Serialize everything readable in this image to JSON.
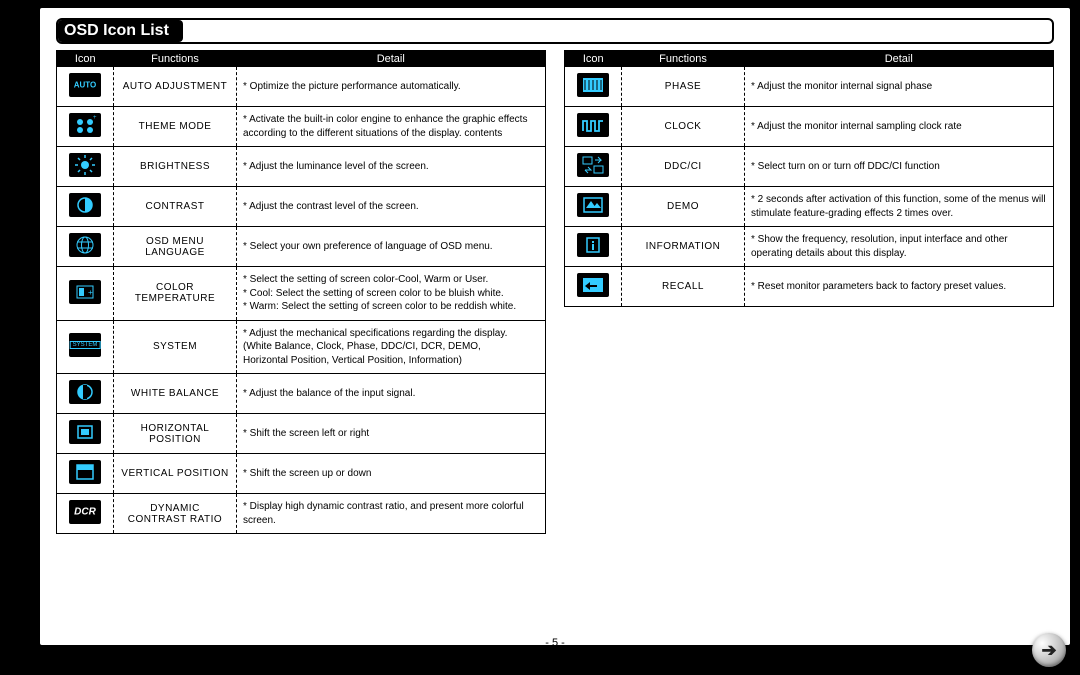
{
  "title": "OSD Icon List",
  "page_number": "- 5 -",
  "headers": {
    "icon": "Icon",
    "fn": "Functions",
    "detail": "Detail"
  },
  "left": [
    {
      "id": "auto",
      "fn": "AUTO ADJUSTMENT",
      "detail": "* Optimize the picture performance automatically."
    },
    {
      "id": "theme",
      "fn": "THEME MODE",
      "detail": "* Activate the built-in color engine to enhance the graphic effects according to the different situations of the display. contents"
    },
    {
      "id": "brightness",
      "fn": "BRIGHTNESS",
      "detail": "* Adjust the luminance level of the screen."
    },
    {
      "id": "contrast",
      "fn": "CONTRAST",
      "detail": "* Adjust the contrast level of the screen."
    },
    {
      "id": "lang",
      "fn": "OSD MENU LANGUAGE",
      "detail": "* Select your own preference of language of OSD menu."
    },
    {
      "id": "colortemp",
      "fn": "COLOR TEMPERATURE",
      "detail": "* Select the setting of screen color-Cool, Warm or User.\n* Cool: Select the setting of screen color to be bluish white.\n* Warm: Select the setting of screen color to be reddish white."
    },
    {
      "id": "system",
      "fn": "SYSTEM",
      "detail": "* Adjust the mechanical specifications regarding the display.\n   (White Balance, Clock, Phase, DDC/CI, DCR, DEMO,\n   Horizontal Position, Vertical Position, Information)"
    },
    {
      "id": "wb",
      "fn": "WHITE BALANCE",
      "detail": "* Adjust the balance of the input signal."
    },
    {
      "id": "hpos",
      "fn": "HORIZONTAL POSITION",
      "detail": "* Shift the screen left or right"
    },
    {
      "id": "vpos",
      "fn": "VERTICAL POSITION",
      "detail": "* Shift the screen up or down"
    },
    {
      "id": "dcr",
      "fn": "DYNAMIC CONTRAST RATIO",
      "detail": "* Display high dynamic contrast ratio, and present more colorful screen."
    }
  ],
  "right": [
    {
      "id": "phase",
      "fn": "PHASE",
      "detail": "* Adjust the monitor internal signal phase"
    },
    {
      "id": "clock",
      "fn": "CLOCK",
      "detail": "* Adjust the monitor internal sampling clock rate"
    },
    {
      "id": "ddcci",
      "fn": "DDC/CI",
      "detail": "* Select turn on or turn off DDC/CI function"
    },
    {
      "id": "demo",
      "fn": "DEMO",
      "detail": "* 2 seconds after activation of this function, some of the menus will stimulate feature-grading effects 2 times over."
    },
    {
      "id": "info",
      "fn": "INFORMATION",
      "detail": "* Show the frequency, resolution, input interface and other operating details about this display."
    },
    {
      "id": "recall",
      "fn": "RECALL",
      "detail": "* Reset monitor parameters back to factory preset values."
    }
  ]
}
